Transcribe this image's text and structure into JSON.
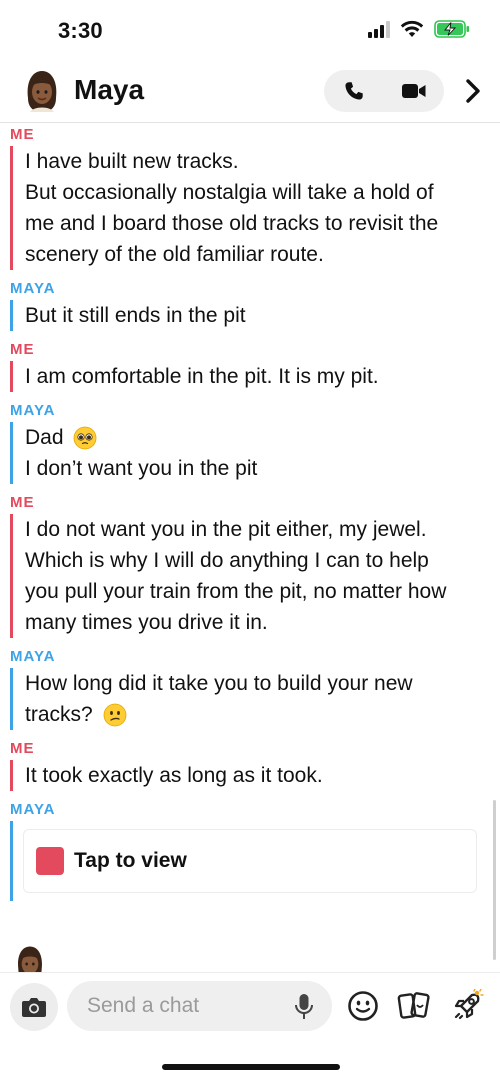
{
  "status": {
    "time": "3:30"
  },
  "header": {
    "name": "Maya"
  },
  "messages": [
    {
      "sender": "ME",
      "lines": [
        "I have built new tracks.",
        "But occasionally nostalgia will take a hold of",
        "me and I board those old tracks to revisit the",
        "scenery of the old familiar route."
      ]
    },
    {
      "sender": "MAYA",
      "lines": [
        "But it still ends in the pit"
      ]
    },
    {
      "sender": "ME",
      "lines": [
        "I am comfortable in the pit. It is my pit."
      ]
    },
    {
      "sender": "MAYA",
      "lines": [
        "Dad",
        "I don’t want you in the pit"
      ]
    },
    {
      "sender": "ME",
      "lines": [
        "I do not want you in the pit either, my jewel.",
        "Which is why I will do anything I can to help",
        "you pull your train from the pit, no matter how",
        "many times you drive it in."
      ]
    },
    {
      "sender": "MAYA",
      "lines": [
        "How long did it take you to build your new",
        "tracks?"
      ]
    },
    {
      "sender": "ME",
      "lines": [
        "It took exactly as long as it took."
      ]
    },
    {
      "sender": "MAYA",
      "snap_label": "Tap to view"
    }
  ],
  "composer": {
    "placeholder": "Send a chat"
  },
  "icons": {
    "voice_call": "phone-icon",
    "video_call": "video-camera-icon",
    "more": "chevron-right-icon",
    "camera": "camera-icon",
    "mic": "microphone-icon",
    "emoji": "smiley-icon",
    "stickers": "sticker-cards-icon",
    "games": "rocket-icon"
  },
  "colors": {
    "me": "#e34a5d",
    "maya": "#3ea3e6",
    "snap": "#e34a5d"
  }
}
